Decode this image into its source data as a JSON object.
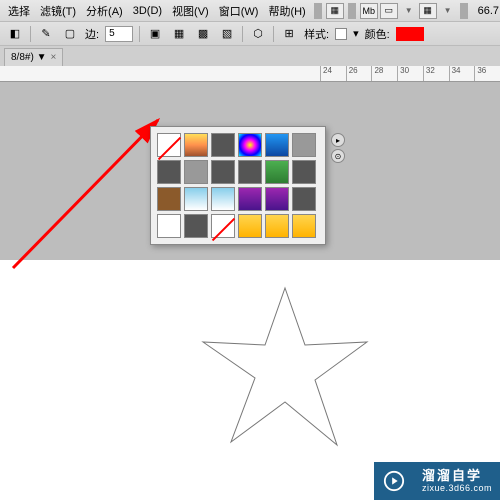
{
  "menu": {
    "items": [
      "选择",
      "滤镜(T)",
      "分析(A)",
      "3D(D)",
      "视图(V)",
      "窗口(W)",
      "帮助(H)"
    ],
    "zoom": "66.7"
  },
  "toolbar": {
    "edge_label": "边:",
    "edge_value": "5",
    "style_label": "样式:",
    "color_label": "颜色:",
    "color_value": "#ff0000"
  },
  "tab": {
    "label": "8/8#) ▼"
  },
  "ruler": {
    "marks": [
      "24",
      "26",
      "28",
      "30",
      "32",
      "34",
      "36"
    ]
  },
  "watermark": {
    "title": "溜溜自学",
    "url": "zixue.3d66.com"
  }
}
